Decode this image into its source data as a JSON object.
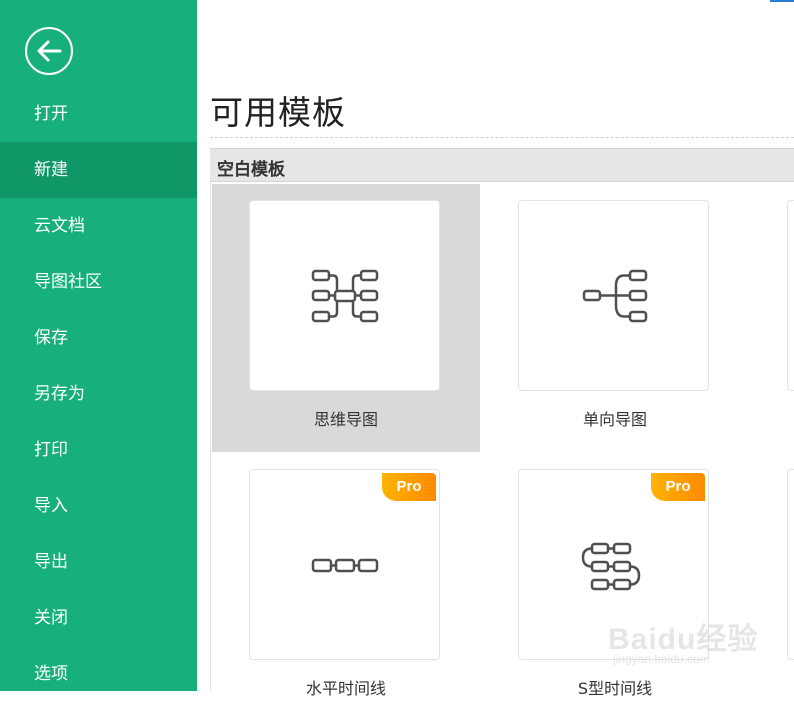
{
  "sidebar": {
    "back_icon": "arrow-left-circle-icon",
    "items": [
      {
        "label": "打开"
      },
      {
        "label": "新建"
      },
      {
        "label": "云文档"
      },
      {
        "label": "导图社区"
      },
      {
        "label": "保存"
      },
      {
        "label": "另存为"
      },
      {
        "label": "打印"
      },
      {
        "label": "导入"
      },
      {
        "label": "导出"
      },
      {
        "label": "关闭"
      },
      {
        "label": "选项"
      }
    ],
    "active_item": "新建"
  },
  "main": {
    "title": "可用模板",
    "section": "空白模板",
    "templates": [
      {
        "label": "思维导图",
        "icon": "mindmap-icon",
        "pro": false,
        "selected": true
      },
      {
        "label": "单向导图",
        "icon": "right-map-icon",
        "pro": false,
        "selected": false
      },
      {
        "label": "水平时间线",
        "icon": "horizontal-timeline-icon",
        "pro": true,
        "pro_label": "Pro",
        "selected": false
      },
      {
        "label": "S型时间线",
        "icon": "s-timeline-icon",
        "pro": true,
        "pro_label": "Pro",
        "selected": false
      }
    ]
  },
  "watermark": {
    "text": "Baidu经验",
    "sub": "jingyan.baidu.com"
  },
  "colors": {
    "sidebar": "#17b07a",
    "active": "#0f9866",
    "pro_badge": "#ff9800"
  }
}
